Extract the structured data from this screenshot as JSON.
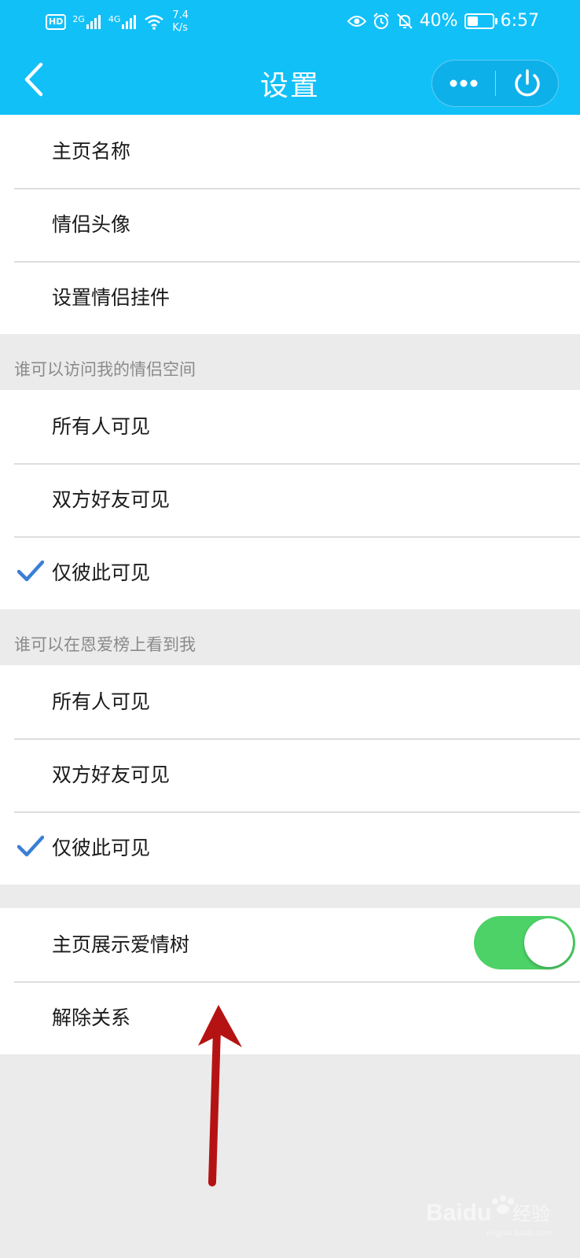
{
  "status_bar": {
    "hd_label": "HD",
    "net1_label": "2G",
    "net2_label": "4G",
    "speed_value": "7.4",
    "speed_unit": "K/s",
    "battery_percent": "40%",
    "battery_level": 0.4,
    "time": "6:57"
  },
  "header": {
    "title": "设置",
    "back_icon": "chevron-left-icon",
    "more_icon": "more-dots-icon",
    "power_icon": "power-icon",
    "background_color": "#12c0f8"
  },
  "profile_group": {
    "items": [
      {
        "label": "主页名称"
      },
      {
        "label": "情侣头像"
      },
      {
        "label": "设置情侣挂件"
      }
    ]
  },
  "space_visibility": {
    "header": "谁可以访问我的情侣空间",
    "options": [
      {
        "label": "所有人可见",
        "selected": false
      },
      {
        "label": "双方好友可见",
        "selected": false
      },
      {
        "label": "仅彼此可见",
        "selected": true
      }
    ]
  },
  "ranking_visibility": {
    "header": "谁可以在恩爱榜上看到我",
    "options": [
      {
        "label": "所有人可见",
        "selected": false
      },
      {
        "label": "双方好友可见",
        "selected": false
      },
      {
        "label": "仅彼此可见",
        "selected": true
      }
    ]
  },
  "misc_group": {
    "show_love_tree": {
      "label": "主页展示爱情树",
      "enabled": true
    },
    "unbind": {
      "label": "解除关系"
    }
  },
  "colors": {
    "accent": "#12c0f8",
    "check": "#3a7fd5",
    "toggle_on": "#4cd266",
    "annotation_arrow": "#b51313"
  },
  "watermark": {
    "brand": "Baidu",
    "suffix": "经验",
    "url": "jingyan.baidu.com"
  }
}
